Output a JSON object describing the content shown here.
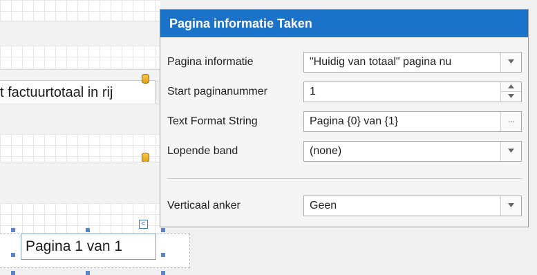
{
  "designer": {
    "label_text": "t factuurtotaal in rij",
    "page_info_text": "Pagina 1 van 1",
    "smart_tag_glyph": "<"
  },
  "tasks_panel": {
    "title": "Pagina informatie Taken",
    "rows": [
      {
        "label": "Pagina informatie",
        "value": "\"Huidig van totaal\" pagina nu",
        "control": "dropdown"
      },
      {
        "label": "Start paginanummer",
        "value": "1",
        "control": "spinner"
      },
      {
        "label": "Text Format String",
        "value": "Pagina {0} van {1}",
        "control": "ellipsis"
      },
      {
        "label": "Lopende band",
        "value": "(none)",
        "control": "dropdown"
      },
      {
        "label": "Verticaal anker",
        "value": "Geen",
        "control": "dropdown"
      }
    ],
    "icons": {
      "dropdown": "chevron-down-icon",
      "spinner_up": "chevron-up-icon",
      "spinner_down": "chevron-down-icon",
      "ellipsis": "ellipsis-icon"
    },
    "ellipsis_glyph": "···"
  },
  "colors": {
    "header_bg": "#1b72c9",
    "header_text": "#ffffff",
    "selection": "#5b86c5",
    "db_icon": "#f0b430"
  }
}
